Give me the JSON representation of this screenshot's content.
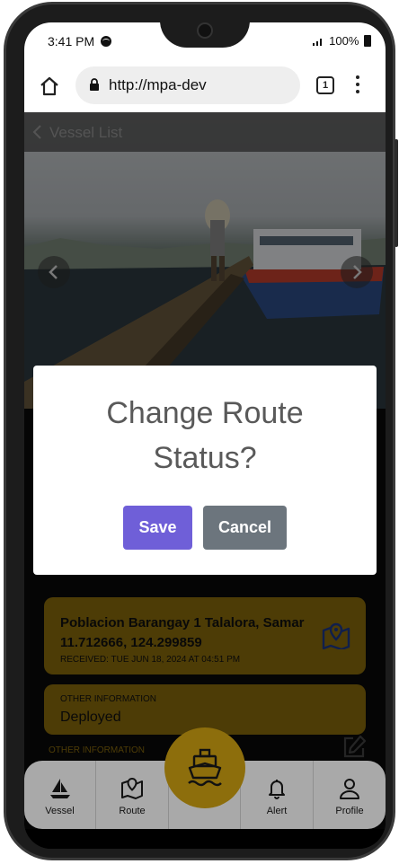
{
  "status_bar": {
    "time": "3:41 PM",
    "signal_text": ".ıl",
    "battery_text": "100%"
  },
  "browser": {
    "url": "http://mpa-dev",
    "tab_count": "1"
  },
  "app_header": {
    "title": "Vessel List"
  },
  "modal": {
    "title": "Change Route Status?",
    "save_label": "Save",
    "cancel_label": "Cancel"
  },
  "location_card": {
    "name": "Poblacion Barangay 1 Talalora, Samar",
    "coords": "11.712666, 124.299859",
    "received": "RECEIVED: TUE JUN 18, 2024 AT 04:51 PM"
  },
  "other_info_card": {
    "label": "OTHER INFORMATION",
    "value": "Deployed"
  },
  "other_info_section": {
    "label": "OTHER INFORMATION"
  },
  "bottom_nav": {
    "items": [
      {
        "label": "Vessel",
        "icon": "sailboat-icon"
      },
      {
        "label": "Route",
        "icon": "map-icon"
      },
      {
        "label": "",
        "icon": "ship-icon"
      },
      {
        "label": "Alert",
        "icon": "bell-icon"
      },
      {
        "label": "Profile",
        "icon": "user-icon"
      }
    ]
  },
  "colors": {
    "accent_gold": "#8d6e0c",
    "save_button": "#6f5fd8",
    "cancel_button": "#6c757d",
    "nav_background": "#a9a9a9"
  }
}
